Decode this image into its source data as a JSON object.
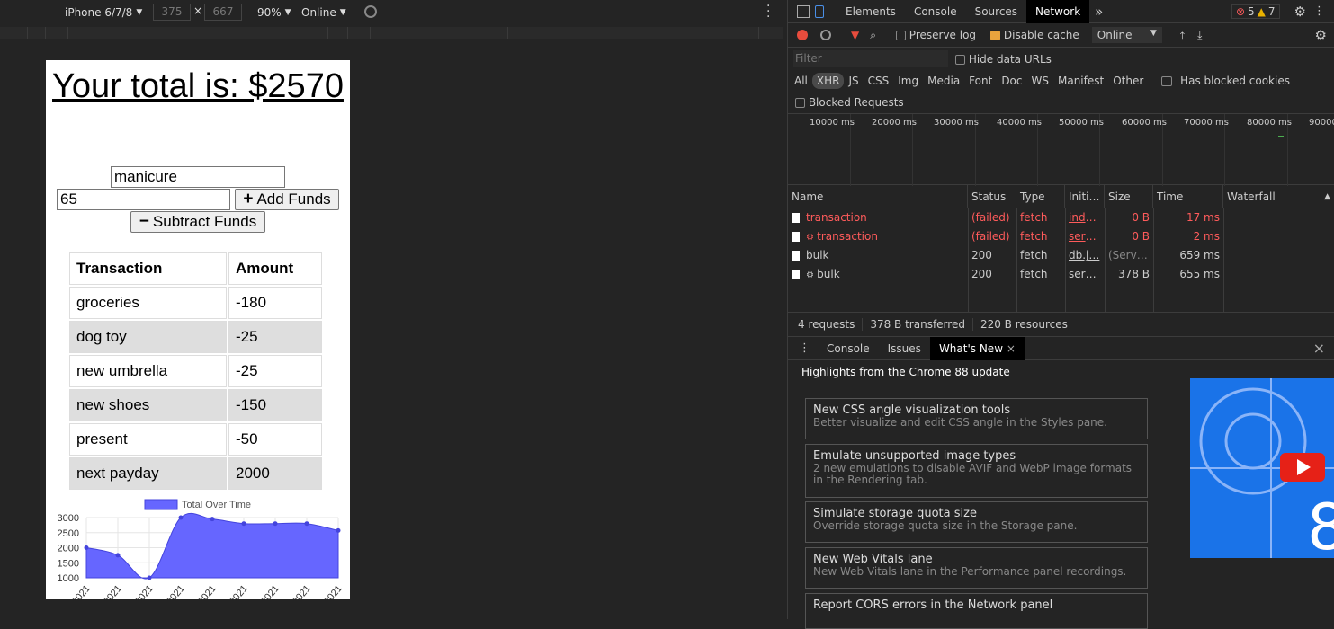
{
  "device_toolbar": {
    "device": "iPhone 6/7/8",
    "width": "375",
    "height": "667",
    "zoom": "90%",
    "network": "Online"
  },
  "app": {
    "total_heading": "Your total is: $2570",
    "name_input_value": "manicure",
    "amount_input_value": "65",
    "add_funds_label": "Add Funds",
    "subtract_funds_label": "Subtract Funds",
    "table_headers": [
      "Transaction",
      "Amount"
    ],
    "transactions": [
      {
        "name": "groceries",
        "amount": "-180"
      },
      {
        "name": "dog toy",
        "amount": "-25"
      },
      {
        "name": "new umbrella",
        "amount": "-25"
      },
      {
        "name": "new shoes",
        "amount": "-150"
      },
      {
        "name": "present",
        "amount": "-50"
      },
      {
        "name": "next payday",
        "amount": "2000"
      }
    ]
  },
  "chart_data": {
    "type": "area",
    "legend": "Total Over Time",
    "y_ticks": [
      "3000",
      "2500",
      "2000",
      "1500",
      "1000"
    ],
    "ylim": [
      1000,
      3000
    ],
    "x_ticks": [
      "2021",
      "2021",
      "2021",
      "2021",
      "2021",
      "2021",
      "2021",
      "2021",
      "2021"
    ],
    "values": [
      2000,
      1750,
      1000,
      3000,
      2950,
      2800,
      2800,
      2800,
      2570
    ],
    "color": "#6666ff"
  },
  "devtools": {
    "tabs": [
      "Elements",
      "Console",
      "Sources",
      "Network"
    ],
    "active_tab": "Network",
    "errors": "5",
    "warnings": "7",
    "toolbar": {
      "preserve_log": "Preserve log",
      "disable_cache": "Disable cache",
      "throttle": "Online"
    },
    "filter_placeholder": "Filter",
    "hide_data_urls": "Hide data URLs",
    "type_filters": [
      "All",
      "XHR",
      "JS",
      "CSS",
      "Img",
      "Media",
      "Font",
      "Doc",
      "WS",
      "Manifest",
      "Other"
    ],
    "has_blocked_cookies": "Has blocked cookies",
    "blocked_requests": "Blocked Requests",
    "timeline_ticks": [
      "10000 ms",
      "20000 ms",
      "30000 ms",
      "40000 ms",
      "50000 ms",
      "60000 ms",
      "70000 ms",
      "80000 ms",
      "90000"
    ],
    "columns": [
      "Name",
      "Status",
      "Type",
      "Initi…",
      "Size",
      "Time",
      "Waterfall"
    ],
    "requests": [
      {
        "name": "transaction",
        "status": "(failed)",
        "type": "fetch",
        "initiator": "inde…",
        "size": "0 B",
        "time": "17 ms",
        "failed": true,
        "sw": false
      },
      {
        "name": "transaction",
        "status": "(failed)",
        "type": "fetch",
        "initiator": "serv…",
        "size": "0 B",
        "time": "2 ms",
        "failed": true,
        "sw": true
      },
      {
        "name": "bulk",
        "status": "200",
        "type": "fetch",
        "initiator": "db.j…",
        "size": "(Servi…",
        "time": "659 ms",
        "failed": false,
        "sw": false
      },
      {
        "name": "bulk",
        "status": "200",
        "type": "fetch",
        "initiator": "serv…",
        "size": "378 B",
        "time": "655 ms",
        "failed": false,
        "sw": true
      }
    ],
    "summary": {
      "requests": "4 requests",
      "transferred": "378 B transferred",
      "resources": "220 B resources"
    },
    "drawer_tabs": [
      "Console",
      "Issues",
      "What's New"
    ],
    "whats_new_header": "Highlights from the Chrome 88 update",
    "cards": [
      {
        "title": "New CSS angle visualization tools",
        "desc": "Better visualize and edit CSS angle in the Styles pane."
      },
      {
        "title": "Emulate unsupported image types",
        "desc": "2 new emulations to disable AVIF and WebP image formats in the Rendering tab."
      },
      {
        "title": "Simulate storage quota size",
        "desc": "Override storage quota size in the Storage pane."
      },
      {
        "title": "New Web Vitals lane",
        "desc": "New Web Vitals lane in the Performance panel recordings."
      },
      {
        "title": "Report CORS errors in the Network panel",
        "desc": ""
      }
    ]
  }
}
